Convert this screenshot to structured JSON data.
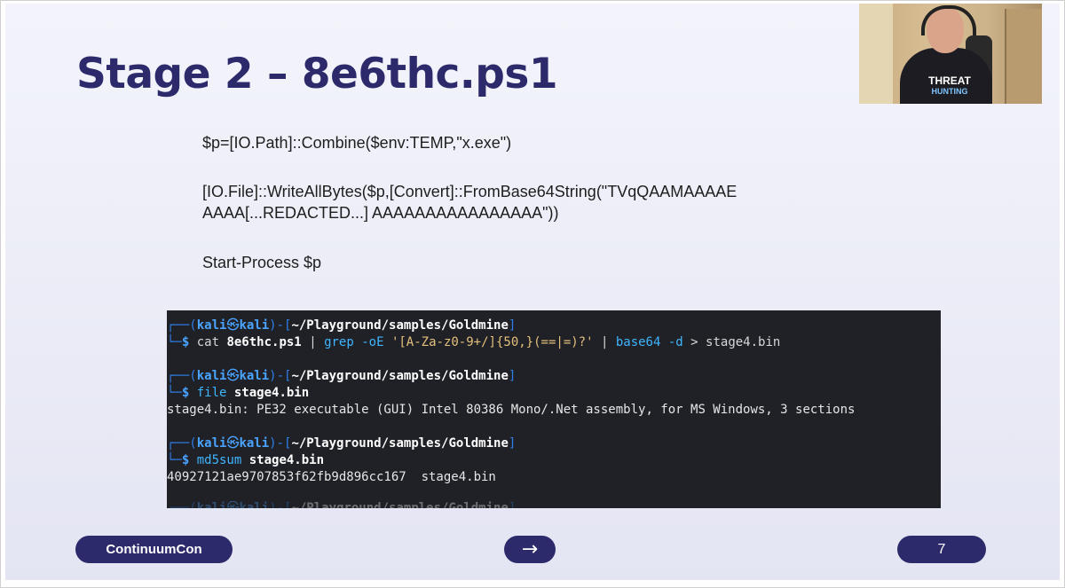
{
  "slide": {
    "title": "Stage 2 – 8e6thc.ps1",
    "code_lines": [
      "$p=[IO.Path]::Combine($env:TEMP,\"x.exe\")",
      "[IO.File]::WriteAllBytes($p,[Convert]::FromBase64String(\"TVqQAAMAAAAE",
      "AAAA[...REDACTED...] AAAAAAAAAAAAAAAA\"))",
      "Start-Process $p"
    ]
  },
  "terminal": {
    "prompt_user": "kali",
    "prompt_symbol": "㉿",
    "prompt_host": "kali",
    "prompt_dir": "~/Playground/samples/Goldmine",
    "cmd1": {
      "program": "cat",
      "arg": "8e6thc.ps1",
      "pipe1": "|",
      "grep": "grep",
      "flag": "-oE",
      "pattern": "'[A-Za-z0-9+/]{50,}(==|=)?'",
      "pipe2": "|",
      "base64": "base64",
      "dflag": "-d",
      "redirect": ">",
      "outfile": "stage4.bin"
    },
    "cmd2": {
      "program": "file",
      "arg": "stage4.bin"
    },
    "out2": "stage4.bin: PE32 executable (GUI) Intel 80386 Mono/.Net assembly, for MS Windows, 3 sections",
    "cmd3": {
      "program": "md5sum",
      "arg": "stage4.bin"
    },
    "out3": "40927121ae9707853f62fb9d896cc167  stage4.bin"
  },
  "footer": {
    "brand": "ContinuumCon",
    "next_arrow": "→",
    "page_number": "7"
  },
  "webcam": {
    "shirt_text_line1": "THREAT",
    "shirt_text_line2": "HUNTING"
  }
}
